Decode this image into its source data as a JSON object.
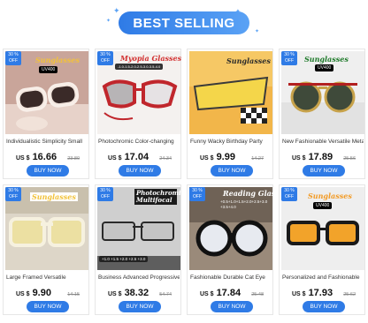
{
  "banner": {
    "title": "BEST SELLING"
  },
  "colors": {
    "accent": "#2f7be6",
    "price": "#111111"
  },
  "products": [
    {
      "badge": "30 % OFF",
      "overlay": "Sunglasses",
      "tag": "UV400",
      "title": "Individualistic Simplicity Small",
      "currency": "US $",
      "price": "16.66",
      "old_price": "23.80",
      "button": "BUY NOW"
    },
    {
      "badge": "30 % OFF",
      "overlay": "Myopia Glasses",
      "tag": "-1.0-1.5-2.0-2.5-3.0-3.5-4.0",
      "title": "Photochromic Color-changing",
      "currency": "US $",
      "price": "17.04",
      "old_price": "24.34",
      "button": "BUY NOW"
    },
    {
      "badge": "",
      "overlay": "Sunglasses",
      "tag": "",
      "title": "Funny Wacky Birthday Party",
      "currency": "US $",
      "price": "9.99",
      "old_price": "14.27",
      "button": "BUY NOW"
    },
    {
      "badge": "30 % OFF",
      "overlay": "Sunglasses",
      "tag": "UV400",
      "title": "New Fashionable Versatile Metal",
      "currency": "US $",
      "price": "17.89",
      "old_price": "25.56",
      "button": "BUY NOW"
    },
    {
      "badge": "30 % OFF",
      "overlay": "Sunglasses",
      "tag": "",
      "title": "Large Framed Versatile",
      "currency": "US $",
      "price": "9.90",
      "old_price": "14.15",
      "button": "BUY NOW"
    },
    {
      "badge": "30 % OFF",
      "overlay": "Photochromic Multifocal",
      "tag": "+1.0 +1.5 +2.0 +2.5 +3.0",
      "title": "Business Advanced Progressive",
      "currency": "US $",
      "price": "38.32",
      "old_price": "54.74",
      "button": "BUY NOW"
    },
    {
      "badge": "30 % OFF",
      "overlay": "Reading Glasses",
      "tag": "+0.5+1.0+1.5+2.0+2.5+3.0 +3.5+4.0",
      "title": "Fashionable Durable Cat Eye",
      "currency": "US $",
      "price": "17.84",
      "old_price": "25.48",
      "button": "BUY NOW"
    },
    {
      "badge": "30 % OFF",
      "overlay": "Sunglasses",
      "tag": "UV400",
      "title": "Personalized and Fashionable",
      "currency": "US $",
      "price": "17.93",
      "old_price": "25.62",
      "button": "BUY NOW"
    }
  ]
}
